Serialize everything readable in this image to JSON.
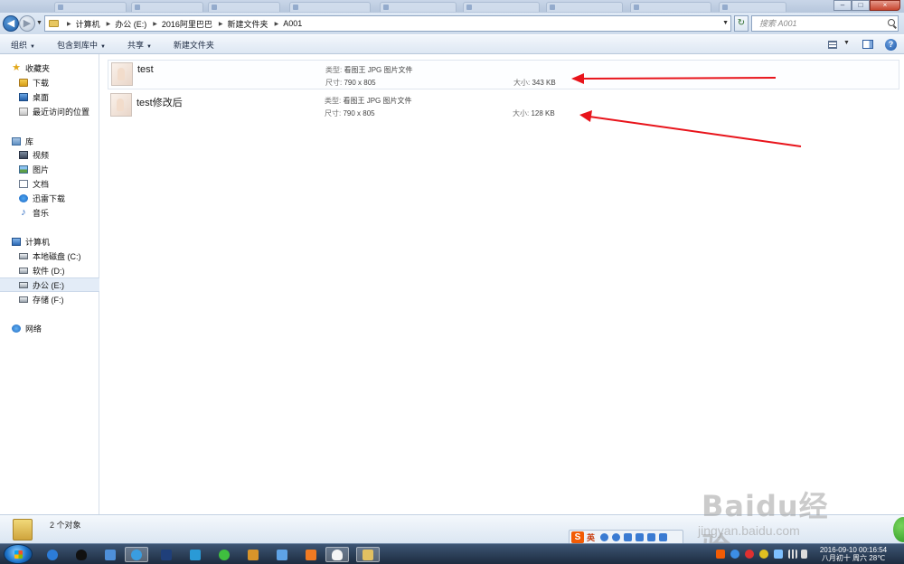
{
  "window": {
    "minimize_label": "–",
    "maximize_label": "□",
    "close_label": "×"
  },
  "address": {
    "breadcrumbs": [
      "计算机",
      "办公 (E:)",
      "2016阿里巴巴",
      "新建文件夹",
      "A001"
    ],
    "search_placeholder": "搜索 A001"
  },
  "toolbar": {
    "organize": "组织",
    "include_in_library": "包含到库中",
    "share": "共享",
    "new_folder": "新建文件夹"
  },
  "nav": {
    "favorites": "收藏夹",
    "downloads": "下载",
    "desktop": "桌面",
    "recent_places": "最近访问的位置",
    "libraries": "库",
    "videos": "视频",
    "pictures": "图片",
    "documents": "文档",
    "xunlei_downloads": "迅雷下载",
    "music": "音乐",
    "computer": "计算机",
    "drive_c": "本地磁盘 (C:)",
    "drive_d": "软件 (D:)",
    "drive_e": "办公 (E:)",
    "drive_f": "存储 (F:)",
    "network": "网络"
  },
  "files": [
    {
      "name": "test",
      "type_label": "类型:",
      "type": "看图王 JPG 图片文件",
      "dim_label": "尺寸:",
      "dimensions": "790 x 805",
      "size_label": "大小:",
      "size": "343 KB"
    },
    {
      "name": "test修改后",
      "type_label": "类型:",
      "type": "看图王 JPG 图片文件",
      "dim_label": "尺寸:",
      "dimensions": "790 x 805",
      "size_label": "大小:",
      "size": "128 KB"
    }
  ],
  "status": {
    "item_count": "2 个对象"
  },
  "ime": {
    "logo": "S",
    "lang": "英"
  },
  "watermark": {
    "brand": "Baidu经验",
    "url": "jingyan.baidu.com"
  },
  "clock": {
    "datetime": "2016-09-10  00:16:54",
    "lunar_weather": "八月初十 周六 28℃"
  },
  "colors": {
    "annotation_arrow": "#e8141b",
    "selection": "#e3ecf7",
    "accent": "#1d5ea8"
  }
}
